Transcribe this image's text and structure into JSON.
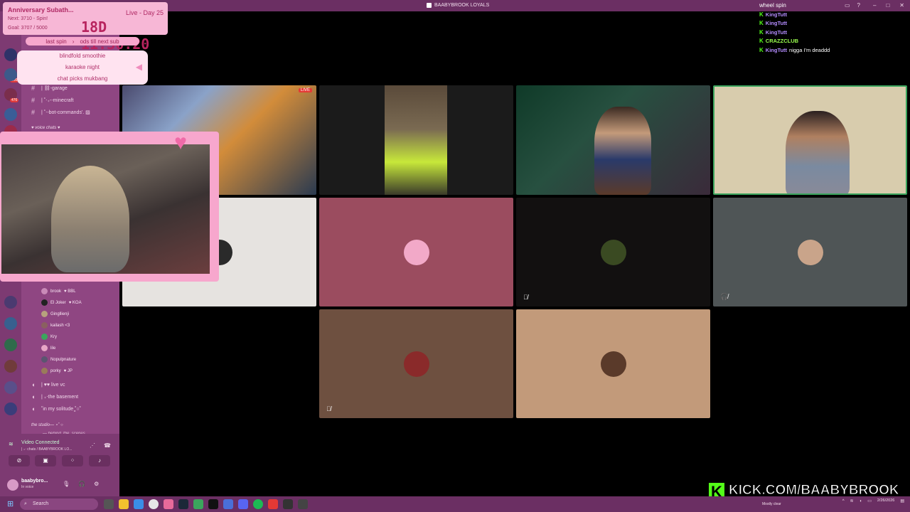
{
  "window": {
    "title": "BAABYBROOK LOYALS"
  },
  "subathon": {
    "title": "Anniversary Subath...",
    "day": "Live - Day 25",
    "next": "Next: 3710 - Spin!",
    "goal": "Goal: 3707 / 5000",
    "timer": "18D  11:36:20",
    "spin_left": "last spin",
    "spin_arrow": "›",
    "spin_right": "ods till next sub"
  },
  "wheel_list": [
    "blindfold smoothie",
    "karaoke night",
    "chat picks mukbang"
  ],
  "sidebar": {
    "badges": [
      "1",
      "966",
      "476"
    ],
    "channels": [
      {
        "icon": "#",
        "label": "| ⛓-garage"
      },
      {
        "icon": "#",
        "label": "| ˚‧₊--minecraft"
      },
      {
        "icon": "#",
        "label": "| ˚‧-bot-commands'. ▨"
      }
    ],
    "voice_category": "♥ voice chats ♥",
    "voice_users": [
      {
        "name": "brook",
        "tag": "♥ BBL"
      },
      {
        "name": "El Joker",
        "tag": "♥ KOA"
      },
      {
        "name": "Gingllienji",
        "tag": ""
      },
      {
        "name": "kailash <3",
        "tag": ""
      },
      {
        "name": "Kry",
        "tag": ""
      },
      {
        "name": "lile",
        "tag": ""
      },
      {
        "name": "Nopulpnature",
        "tag": ""
      },
      {
        "name": "porky",
        "tag": "♥ JP"
      }
    ],
    "voice_channels": [
      {
        "label": "| ♥♥ live vc"
      },
      {
        "label": "| ₊‧the basement"
      },
      {
        "label": "˚in my solitude ̳˚○˚"
      }
    ],
    "studio_category": "the studio— ⋆˚ ○",
    "studio_sub": "— behind_the_scenes"
  },
  "voice_panel": {
    "status": "Video Connected",
    "sub": "| ₊‧ chats / BAABYBROOK LO...",
    "username": "baabybro...",
    "user_status": "In voice"
  },
  "chat": {
    "header": "wheel spin",
    "messages": [
      {
        "user": "KingTutt",
        "text": "",
        "color": "#b48cff"
      },
      {
        "user": "KingTutt",
        "text": "",
        "color": "#b48cff"
      },
      {
        "user": "KingTutt",
        "text": "",
        "color": "#b48cff"
      },
      {
        "user": "CRAZZCLUB",
        "text": "",
        "color": "#9bff4f"
      },
      {
        "user": "KingTutt",
        "text": "nigga I'm deaddd",
        "color": "#b48cff"
      }
    ]
  },
  "branding": {
    "kick_logo": "K",
    "kick_url": "KICK.COM/BAABYBROOK"
  },
  "taskbar": {
    "search": "Search",
    "weather": "Mostly clear",
    "time": "",
    "date": "2/26/2026"
  },
  "tiles": [
    {
      "name": "game-stream-tile",
      "bg": "#3a3a55"
    },
    {
      "name": "beanie-guy-tile",
      "bg": "#1b1b1b"
    },
    {
      "name": "gamer-room-tile",
      "bg": "#1d3a2a"
    },
    {
      "name": "glasses-guy-tile",
      "bg": "#d8ccad"
    },
    {
      "name": "white-avatar-tile",
      "bg": "#e6e3e0"
    },
    {
      "name": "pink-avatar-tile",
      "bg": "#9b4c5f"
    },
    {
      "name": "dark-avatar-tile",
      "bg": "#121010"
    },
    {
      "name": "grey-avatar-tile",
      "bg": "#4f5556"
    },
    {
      "name": "brown-avatar-tile",
      "bg": "#6e5040"
    },
    {
      "name": "tan-avatar-tile",
      "bg": "#c29a7a"
    }
  ]
}
